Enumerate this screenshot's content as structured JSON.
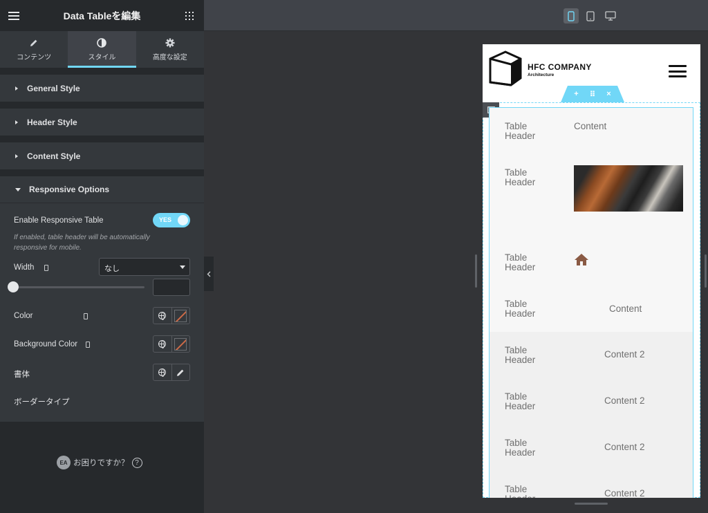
{
  "panel": {
    "title": "Data Tableを編集",
    "tabs": [
      {
        "label": "コンテンツ",
        "icon": "pencil-icon"
      },
      {
        "label": "スタイル",
        "icon": "contrast-icon"
      },
      {
        "label": "高度な設定",
        "icon": "gear-icon"
      }
    ],
    "sections": [
      {
        "label": "General Style"
      },
      {
        "label": "Header Style"
      },
      {
        "label": "Content Style"
      },
      {
        "label": "Responsive Options"
      }
    ],
    "responsive": {
      "enable_label": "Enable Responsive Table",
      "toggle_text": "YES",
      "hint": "If enabled, table header will be automatically responsive for mobile.",
      "width_label": "Width",
      "width_value": "",
      "color_label": "Color",
      "bg_color_label": "Background Color",
      "typography_label": "書体",
      "border_type_label": "ボーダータイプ",
      "border_type_value": "なし"
    },
    "help_text": "お困りですか？",
    "help_logo": "EA"
  },
  "accent_color": "#71d7f7",
  "preview": {
    "brand": {
      "name": "HFC COMPANY",
      "tagline": "Architecture"
    },
    "rows": [
      {
        "header": "Table Header",
        "content": "Content"
      },
      {
        "header": "Table Header",
        "content": ""
      },
      {
        "header": "Table Header",
        "content": "home-icon"
      },
      {
        "header": "Table Header",
        "content": "Content"
      },
      {
        "header": "Table Header",
        "content": "Content 2"
      },
      {
        "header": "Table Header",
        "content": "Content 2"
      },
      {
        "header": "Table Header",
        "content": "Content 2"
      },
      {
        "header": "Table Header",
        "content": "Content 2"
      }
    ]
  }
}
